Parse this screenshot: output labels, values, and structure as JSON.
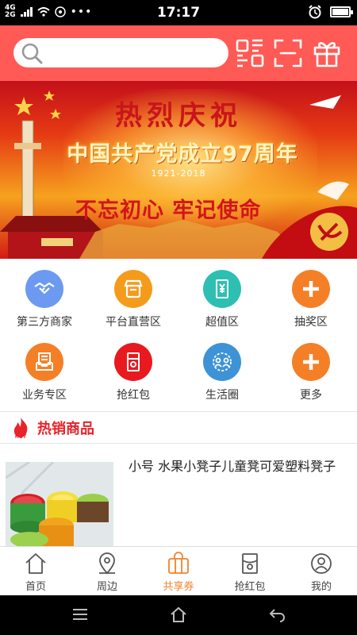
{
  "status": {
    "network_top": "4G",
    "network_bottom": "2G",
    "time": "17:17",
    "dots": "•••"
  },
  "header": {
    "search_placeholder": "",
    "icons": [
      "qrcode-icon",
      "scan-icon",
      "gift-icon"
    ]
  },
  "banner": {
    "title": "热烈庆祝",
    "subtitle": "中国共产党成立97周年",
    "years": "1921-2018",
    "slogan": "不忘初心 牢记使命"
  },
  "categories": [
    {
      "label": "第三方商家",
      "icon": "handshake-icon",
      "color": "#6b9af0"
    },
    {
      "label": "平台直营区",
      "icon": "store-icon",
      "color": "#f59b1c"
    },
    {
      "label": "超值区",
      "icon": "receipt-yen-icon",
      "color": "#2ebfb3"
    },
    {
      "label": "抽奖区",
      "icon": "plus-icon",
      "color": "#f57f27"
    },
    {
      "label": "业务专区",
      "icon": "document-tray-icon",
      "color": "#f57f27"
    },
    {
      "label": "抢红包",
      "icon": "red-packet-icon",
      "color": "#e81a1f"
    },
    {
      "label": "生活圈",
      "icon": "people-circle-icon",
      "color": "#3d93d6"
    },
    {
      "label": "更多",
      "icon": "plus-icon",
      "color": "#f57f27"
    }
  ],
  "hot_section": {
    "badge": "HOT",
    "title": "热销商品"
  },
  "products": [
    {
      "title": "小号 水果小凳子儿童凳可爱塑料凳子"
    }
  ],
  "tabs": [
    {
      "label": "首页",
      "icon": "home-icon",
      "active": false
    },
    {
      "label": "周边",
      "icon": "location-pin-icon",
      "active": false
    },
    {
      "label": "共享券",
      "icon": "shopping-bag-icon",
      "active": true
    },
    {
      "label": "抢红包",
      "icon": "red-packet-icon",
      "active": false
    },
    {
      "label": "我的",
      "icon": "user-icon",
      "active": false
    }
  ],
  "colors": {
    "header": "#ff5a55",
    "accent": "#f1822c",
    "hot": "#e8232a"
  }
}
